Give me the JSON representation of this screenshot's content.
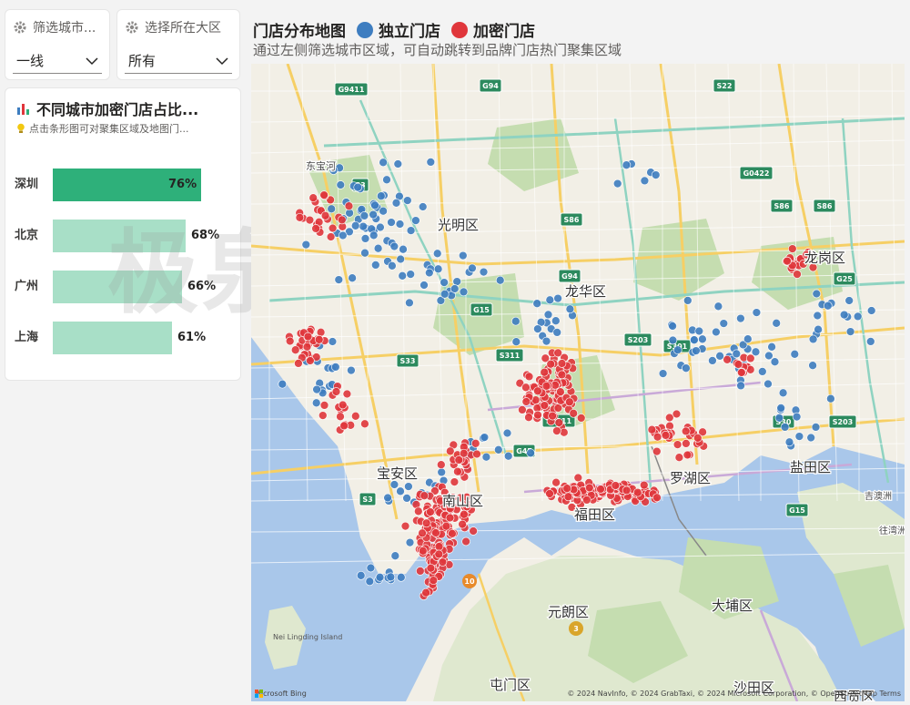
{
  "slicers": [
    {
      "label": "筛选城市...",
      "value": "一线"
    },
    {
      "label": "选择所在大区",
      "value": "所有"
    }
  ],
  "bar_card": {
    "title": "不同城市加密门店占比...",
    "subtitle": "点击条形图可对聚集区域及地图门..."
  },
  "chart_data": {
    "type": "bar",
    "orientation": "horizontal",
    "categories": [
      "深圳",
      "北京",
      "广州",
      "上海"
    ],
    "values": [
      76,
      68,
      66,
      61
    ],
    "value_labels": [
      "76%",
      "68%",
      "66%",
      "61%"
    ],
    "selected_category": "深圳",
    "colors": {
      "selected": "#2eb07a",
      "default": "#a8dfc7"
    }
  },
  "watermark": "极泉  Ideabi",
  "map": {
    "title": "门店分布地图",
    "legend": [
      {
        "label": "独立门店",
        "color": "#3e7dc0"
      },
      {
        "label": "加密门店",
        "color": "#e0363b"
      }
    ],
    "subtitle": "通过左侧筛选城市区域，可自动跳转到品牌门店热门聚集区域",
    "district_labels": [
      "光明区",
      "龙华区",
      "龙岗区",
      "宝安区",
      "南山区",
      "福田区",
      "罗湖区",
      "盐田区",
      "元朗区",
      "大埔区",
      "屯门区",
      "沙田区",
      "西贡区",
      "东宝河",
      "吉澳洲",
      "往湾洲"
    ],
    "road_shields": [
      "G9411",
      "G94",
      "S22",
      "S3",
      "G0422",
      "S86",
      "S86",
      "S86",
      "G94",
      "G15",
      "G25",
      "S33",
      "S311",
      "S203",
      "S301",
      "S3111",
      "G4E",
      "S30",
      "S203",
      "S3",
      "G15",
      "10",
      "3"
    ],
    "attribution": "© 2024 NavInfo, © 2024 GrabTaxi, © 2024 Microsoft Corporation, © OpenStreetMap  Terms",
    "provider": "Microsoft Bing",
    "island_label": "Nei Lingding Island"
  }
}
